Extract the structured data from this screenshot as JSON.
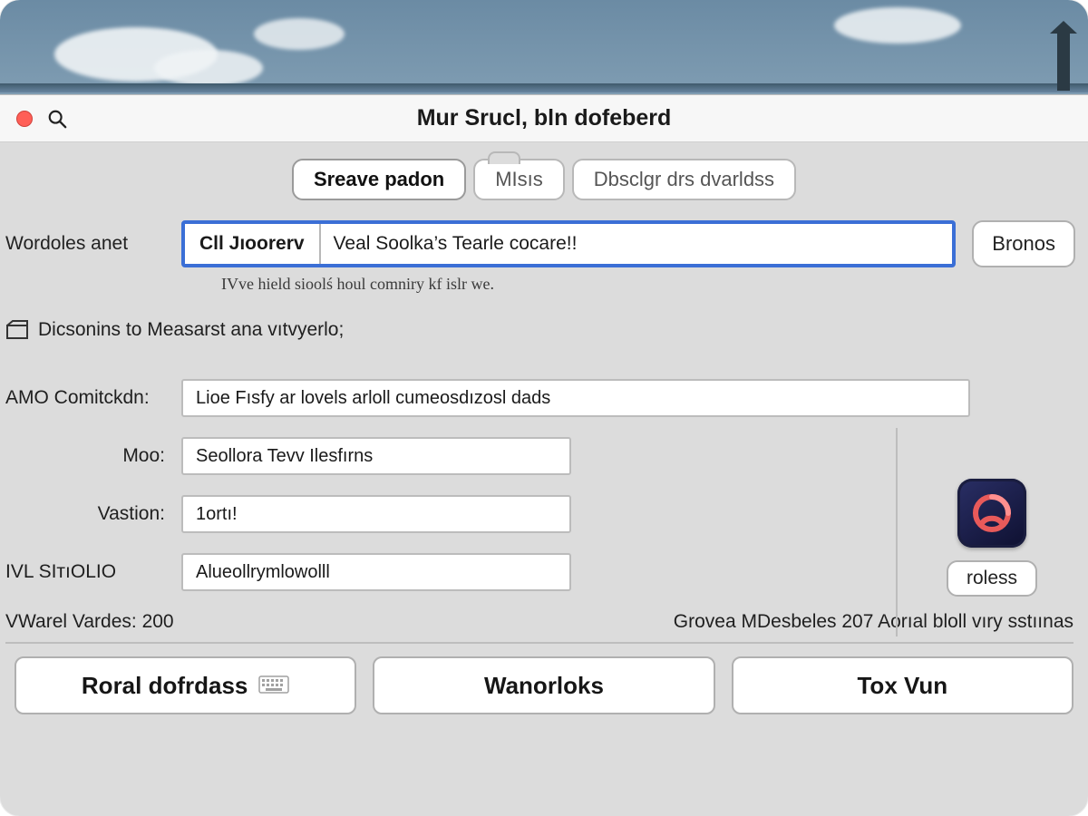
{
  "window": {
    "title": "Mur Srucl, bln dofeberd"
  },
  "tabs": [
    {
      "label": "Sreave padon",
      "active": true
    },
    {
      "label": "MIsıs",
      "active": false
    },
    {
      "label": "Dbsclgr drs dvarldss",
      "active": false
    }
  ],
  "address": {
    "label": "Wordoles anet",
    "segment": "Cll Jıoorerv",
    "value": "Veal Soolka’s Tearle cocare!!",
    "caption": "IVve hield sioolś houl comniry kf islr    we.",
    "button": "Bronos"
  },
  "notice": "Dicsonins to Measarst ana vıtvyerlo;",
  "form": {
    "comickdn": {
      "label": "AMO Comitckdn:",
      "value": "Lioe Fısfy ar lovels arloll cumeosdızosl dads"
    },
    "moo": {
      "label": "Moo:",
      "value": "Seollora Tevv Ilesfırns"
    },
    "vastion": {
      "label": "Vastion:",
      "value": "1ortı!"
    },
    "studio": {
      "label": "IVL SIтıOLIO",
      "value": "Alueollrymlowolll"
    }
  },
  "side": {
    "button": "roless"
  },
  "stats": {
    "left_label": "VWarel Vardes:",
    "left_value": "200",
    "right": "Grovea MDesbeles 207 Aorıal bloll vıry sstıınas"
  },
  "bottom": [
    "Roral dofrdass",
    "Wanorloks",
    "Tox Vun"
  ]
}
